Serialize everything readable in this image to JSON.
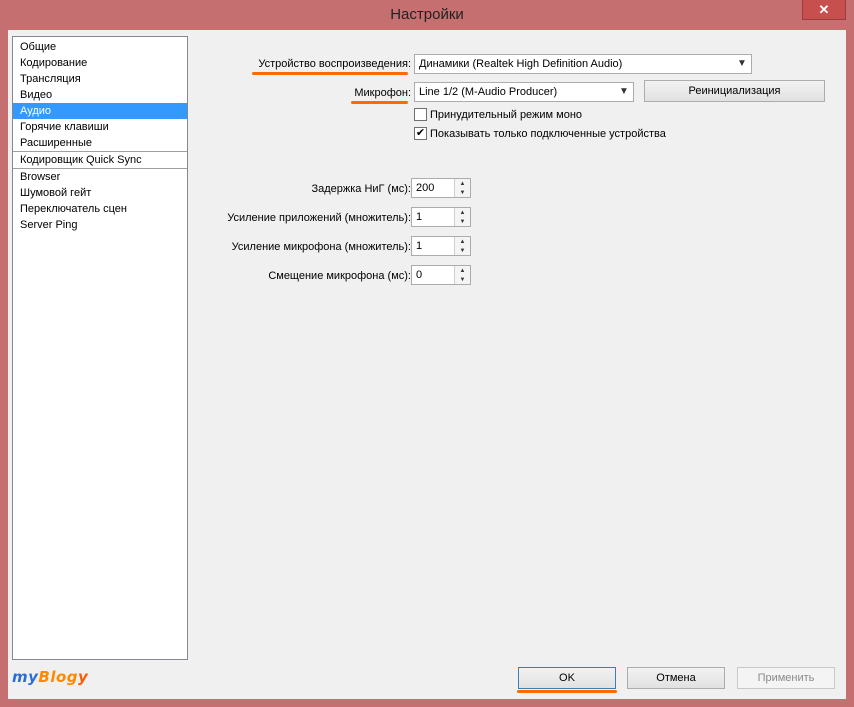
{
  "window": {
    "title": "Настройки",
    "close_glyph": "✕"
  },
  "nav": {
    "items": [
      "Общие",
      "Кодирование",
      "Трансляция",
      "Видео",
      "Аудио",
      "Горячие клавиши",
      "Расширенные",
      "Кодировщик Quick Sync",
      "Browser",
      "Шумовой гейт",
      "Переключатель сцен",
      "Server Ping"
    ],
    "selected": "Аудио"
  },
  "audio": {
    "playback_label": "Устройство воспроизведения:",
    "playback_value": "Динамики (Realtek High Definition Audio)",
    "mic_label": "Микрофон:",
    "mic_value": "Line 1/2 (M-Audio Producer)",
    "reinit_label": "Реинициализация",
    "force_mono_label": "Принудительный режим моно",
    "force_mono_checked": false,
    "show_connected_label": "Показывать только подключенные устройства",
    "show_connected_checked": true,
    "delay_label": "Задержка НиГ (мс):",
    "delay_value": "200",
    "app_gain_label": "Усиление приложений (множитель):",
    "app_gain_value": "1",
    "mic_gain_label": "Усиление микрофона (множитель):",
    "mic_gain_value": "1",
    "mic_offset_label": "Смещение микрофона (мс):",
    "mic_offset_value": "0"
  },
  "footer": {
    "ok_label": "OK",
    "cancel_label": "Отмена",
    "apply_label": "Применить"
  },
  "logo": {
    "part1": "my",
    "part2": "Blog",
    "part3": "y"
  },
  "colors": {
    "frame": "#c56f70",
    "selection": "#3399ff",
    "highlight": "#ff6a00"
  }
}
